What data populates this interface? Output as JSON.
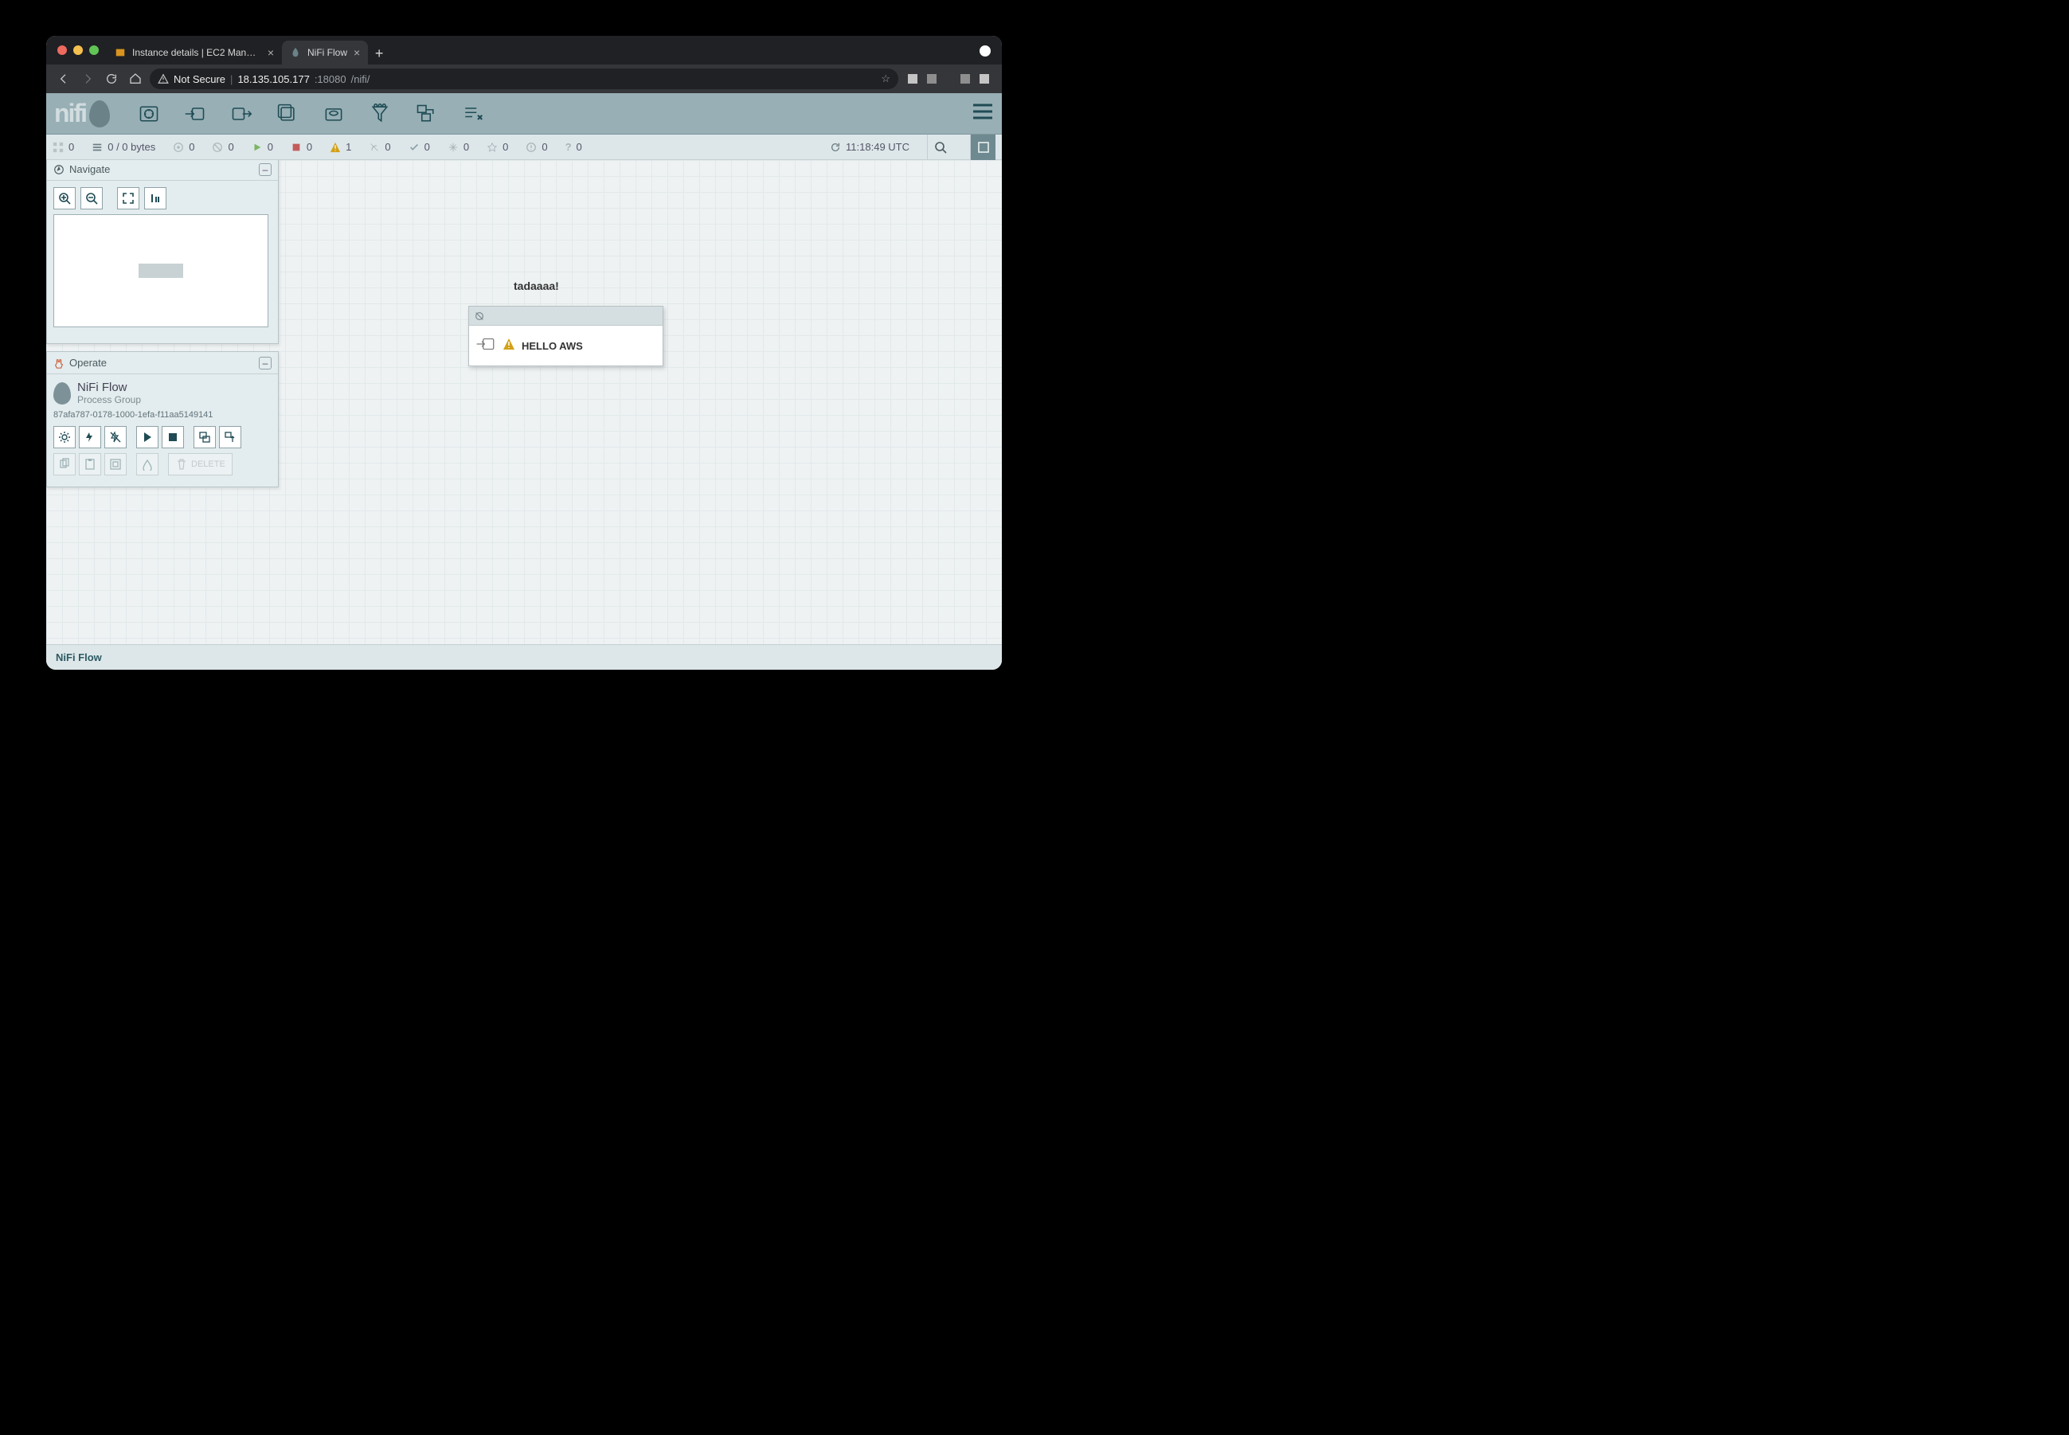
{
  "browser": {
    "tabs": [
      {
        "label": "Instance details | EC2 Manager",
        "active": false
      },
      {
        "label": "NiFi Flow",
        "active": true
      }
    ],
    "not_secure": "Not Secure",
    "url_host": "18.135.105.177",
    "url_port": ":18080",
    "url_path": "/nifi/"
  },
  "logo_text": "nifi",
  "status": {
    "groups": "0",
    "queued": "0 / 0 bytes",
    "remote_in": "0",
    "remote_out": "0",
    "running": "0",
    "stopped": "0",
    "invalid": "1",
    "disabled": "0",
    "up_to_date": "0",
    "stale": "0",
    "sync_fail": "0",
    "bulletin": "0",
    "unknown": "0",
    "refreshed": "11:18:49 UTC"
  },
  "navigate": {
    "title": "Navigate"
  },
  "operate": {
    "title": "Operate",
    "flow_name": "NiFi Flow",
    "flow_type": "Process Group",
    "uuid": "87afa787-0178-1000-1efa-f11aa5149141",
    "delete": "DELETE"
  },
  "canvas": {
    "label_text": "tadaaaa!",
    "processor_name": "HELLO AWS"
  },
  "footer": {
    "breadcrumb": "NiFi Flow"
  }
}
